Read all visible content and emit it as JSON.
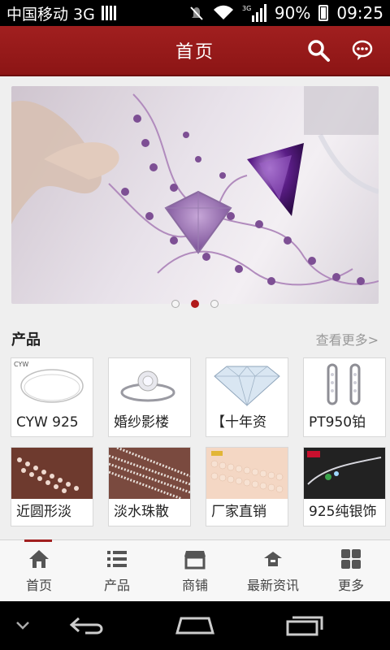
{
  "status_bar": {
    "carrier": "中国移动 3G",
    "network_tag": "3G",
    "battery": "90%",
    "time": "09:25"
  },
  "header": {
    "title": "首页",
    "search_icon": "search-icon",
    "chat_icon": "chat-icon"
  },
  "banner": {
    "slide_count": 3,
    "active_slide": 2
  },
  "products_section": {
    "title": "产品",
    "more_label": "查看更多>",
    "items": [
      {
        "label": "CYW 925",
        "icon": "necklace-chain"
      },
      {
        "label": "婚纱影楼",
        "icon": "diamond-ring"
      },
      {
        "label": "【十年资",
        "icon": "diamond"
      },
      {
        "label": "PT950铂",
        "icon": "hoop-earrings"
      },
      {
        "label": "近圆形淡",
        "icon": "pearl-strands"
      },
      {
        "label": "淡水珠散",
        "icon": "pearl-strands-white"
      },
      {
        "label": "厂家直销",
        "icon": "pearl-pile"
      },
      {
        "label": "925纯银饰",
        "icon": "silver-bracelet"
      }
    ]
  },
  "bottom_nav": {
    "items": [
      {
        "label": "首页",
        "icon": "home-icon"
      },
      {
        "label": "产品",
        "icon": "list-icon"
      },
      {
        "label": "商铺",
        "icon": "shop-icon"
      },
      {
        "label": "最新资讯",
        "icon": "news-icon"
      },
      {
        "label": "更多",
        "icon": "grid-icon"
      }
    ]
  },
  "colors": {
    "brand": "#a11f1f",
    "background": "#efefef",
    "muted_text": "#999999"
  }
}
